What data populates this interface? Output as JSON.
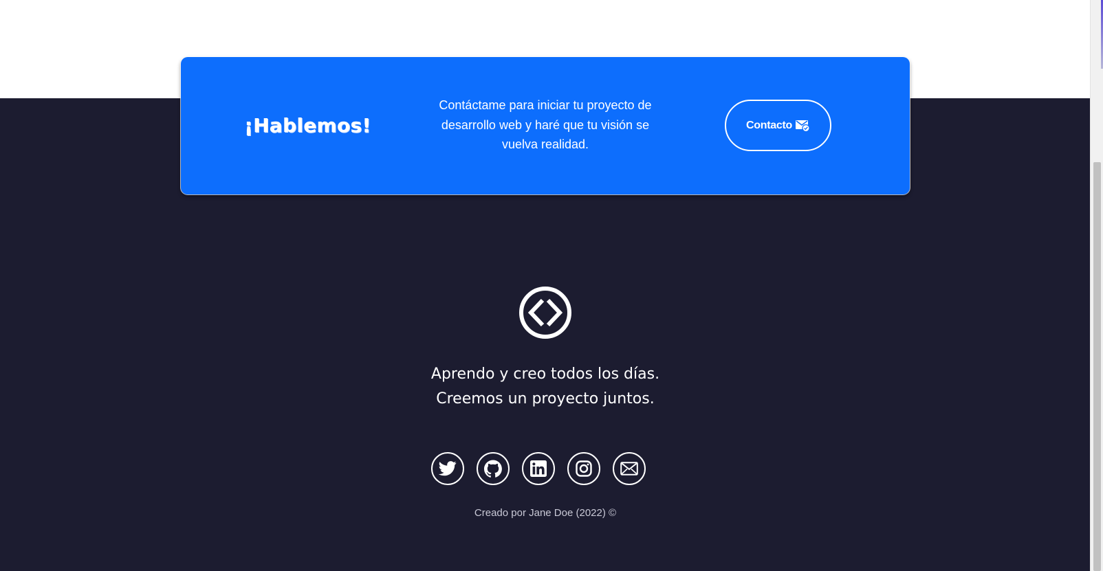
{
  "cta": {
    "title": "¡Hablemos!",
    "text": "Contáctame para iniciar tu proyecto de desarrollo web y haré que tu visión se vuelva realidad.",
    "button_label": "Contacto",
    "button_icon": "envelope-check-icon"
  },
  "footer": {
    "logo_icon": "code-brackets-icon",
    "tagline_line1": "Aprendo y creo todos los días.",
    "tagline_line2": "Creemos un proyecto juntos.",
    "social": [
      {
        "label": "Twitter",
        "icon": "twitter-icon"
      },
      {
        "label": "GitHub",
        "icon": "github-icon"
      },
      {
        "label": "LinkedIn",
        "icon": "linkedin-icon"
      },
      {
        "label": "Instagram",
        "icon": "instagram-icon"
      },
      {
        "label": "Email",
        "icon": "envelope-icon"
      }
    ],
    "credit": "Creado por Jane Doe (2022) ©"
  },
  "colors": {
    "accent": "#0d6efd",
    "footer_bg": "#1c1c30",
    "text": "#ffffff"
  }
}
